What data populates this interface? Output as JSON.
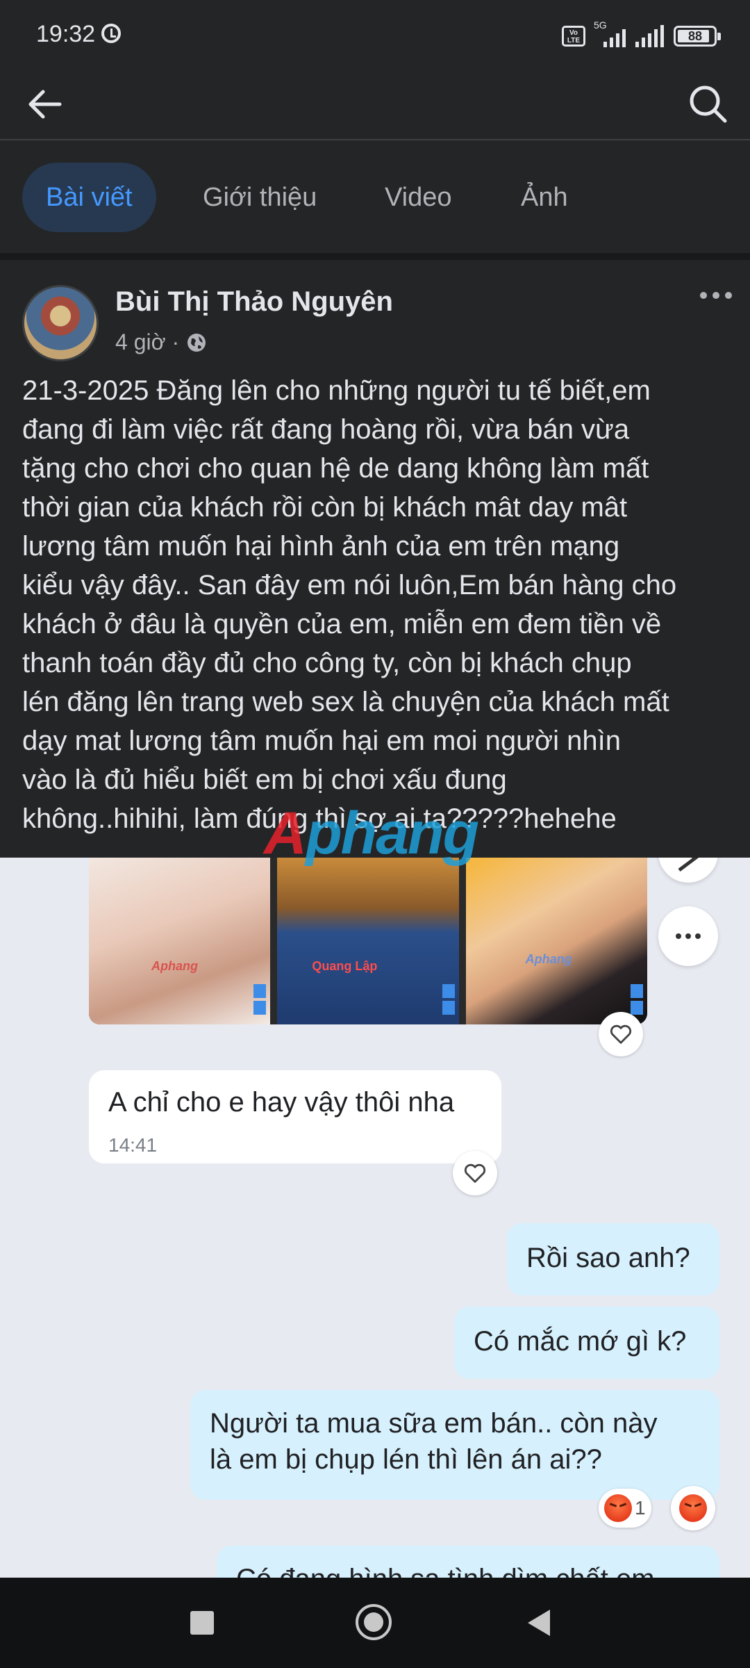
{
  "status_bar": {
    "time": "19:32",
    "network": "5G",
    "volte": "Vo LTE",
    "battery": "88"
  },
  "tabs": [
    {
      "label": "Bài viết",
      "active": true
    },
    {
      "label": "Giới thiệu",
      "active": false
    },
    {
      "label": "Video",
      "active": false
    },
    {
      "label": "Ảnh",
      "active": false
    }
  ],
  "post": {
    "author": "Bùi Thị Thảo Nguyên",
    "time": "4 giờ ·",
    "text": "21-3-2025 Đăng lên cho những người tu tế biết,em\nđang đi làm việc rất đang hoàng rồi, vừa bán vừa\ntặng cho chơi cho quan hệ de dang không làm mất\nthời gian của khách rồi còn bị khách mât day mât\nlương tâm muốn hại hình ảnh của em trên mạng\nkiểu vậy đây.. San đây em nói luôn,Em bán hàng cho\nkhách ở đâu là quyền của em, miễn em đem tiền về\nthanh toán đầy đủ cho công ty, còn bị khách chụp\nlén đăng lên trang web sex là chuyện của khách mất\ndạy mat lương tâm muốn hại em moi người nhìn\nvào là đủ hiểu biết em bị chơi xấu đung\nkhông..hihihi, làm đúng thì sợ ai ta?????hehehe"
  },
  "watermark": {
    "a": "A",
    "rest": "phang"
  },
  "chat": {
    "photo_labels": [
      "Aphang",
      "Quang Lập",
      "Aphang"
    ],
    "incoming": {
      "text": "A chỉ cho e hay vậy thôi nha",
      "time": "14:41"
    },
    "outgoing": [
      {
        "text": "Rồi sao anh?"
      },
      {
        "text": "Có mắc mớ gì k?"
      },
      {
        "text": "Người ta mua sữa em bán.. còn này\nlà em bị chụp lén thì lên án ai??"
      }
    ],
    "reaction_count": "1",
    "partial_text": "Có đang hình sa tình dìm chất em"
  },
  "colors": {
    "bg": "#242526",
    "accent": "#4599ff",
    "chat_bg": "#e7eaf1",
    "bubble_out": "#d6f1fd"
  }
}
